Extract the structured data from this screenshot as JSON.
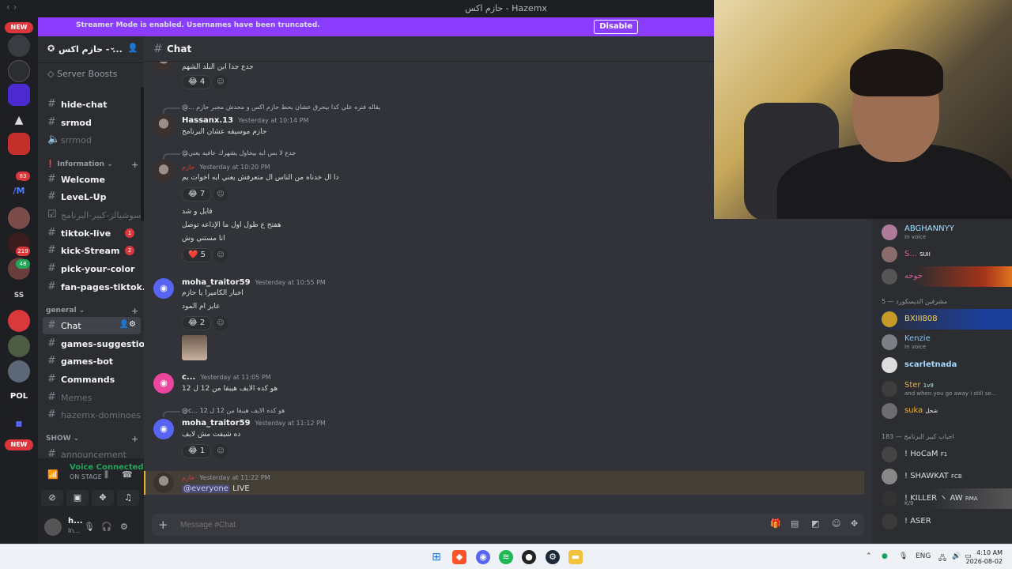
{
  "window": {
    "title": "حازم اكس - Hazemx"
  },
  "banner": {
    "text": "Streamer Mode is enabled. Usernames have been truncated.",
    "button": "Disable"
  },
  "guilds": {
    "new_top": "NEW",
    "new_bottom": "NEW",
    "badge_83": "83",
    "badge_219": "219",
    "badge_48": "48",
    "ss": "SS"
  },
  "server": {
    "name": "حازم اكس - ...",
    "boosts": "Server Boosts"
  },
  "channels": {
    "hide_chat": "hide-chat",
    "srmod": "srmod",
    "srrmod": "srrmod",
    "cat_information": "Information",
    "welcome": "Welcome",
    "level_up": "LeveL-Up",
    "social": "سوشيالز-كبير-البرنامج",
    "tiktok_live": "tiktok-live",
    "tiktok_badge": "1",
    "kick_stream": "kick-Stream",
    "kick_badge": "2",
    "pick_color": "pick-your-color",
    "fan_pages": "fan-pages-tiktok...",
    "cat_general": "general",
    "chat": "Chat",
    "games_suggestions": "games-suggestions",
    "games_bot": "games-bot",
    "commands": "Commands",
    "memes": "Memes",
    "dominoes": "hazemx-dominoes",
    "cat_show": "SHOW",
    "announcement": "announcement"
  },
  "voice": {
    "status": "Voice Connected",
    "stage": "ON STAGE"
  },
  "user": {
    "name": "h...",
    "status": "In..."
  },
  "chat": {
    "channel": "Chat",
    "placeholder": "Message #Chat",
    "messages": [
      {
        "text": "جدع جدا ابن البلد الشهم",
        "reaction": "😂",
        "count": "4"
      },
      {
        "reply": "@... يقاله فتره علي كدا بيحرق عشان يحط حازم اكس و محدش مجبر حازم",
        "name": "Hassanx.13",
        "time": "Yesterday at 10:14 PM",
        "text": "حازم موسيقه عشان البرنامج"
      },
      {
        "reply": "@جدع لا بس ايه بيحاول يشهرك عافيه يعني",
        "name": "حازم",
        "time": "Yesterday at 10:20 PM",
        "text": "دا ال خدناه من الناس ال متعرفش يعني ايه اخوات يم",
        "reaction": "😂",
        "count": "7"
      },
      {
        "text": "قايل و شد"
      },
      {
        "text": "هفتح ع طول اول ما الإذاعه توصل"
      },
      {
        "text": "انا مستني وش",
        "reaction": "❤️",
        "count": "5"
      },
      {
        "name": "moha_traitor59",
        "time": "Yesterday at 10:55 PM",
        "text": "اخبار الكاميرا يا حازم"
      },
      {
        "text": "عايز ام المود",
        "reaction": "😂",
        "count": "2"
      },
      {
        "name": "c...",
        "time": "Yesterday at 11:05 PM",
        "text": "هو كده الايف هيبقا من 12 ل 12"
      },
      {
        "reply": "@c... هو كده الايف هيبقا من 12 ل 12",
        "name": "moha_traitor59",
        "time": "Yesterday at 11:12 PM",
        "text": "ده شيفت مش لايف",
        "reaction": "😂",
        "count": "1"
      },
      {
        "name": "حازم",
        "time": "Yesterday at 11:22 PM",
        "mention": "@everyone",
        "text": "LIVE"
      }
    ]
  },
  "members": {
    "cat_mods": "مشرفين الديسكورد — 5",
    "cat_fans": "احباب كبير البرنامج — 183",
    "list": [
      {
        "name": "ABGHANNYY",
        "sub": "In voice"
      },
      {
        "name": "S...",
        "tag": "SUII"
      },
      {
        "name": "خوخه"
      },
      {
        "name": "BXIII808"
      },
      {
        "name": "Kenzie",
        "sub": "In voice"
      },
      {
        "name": "scarletnada"
      },
      {
        "name": "Ster",
        "tag": "1v9",
        "sub": "and when you go away i still se..."
      },
      {
        "name": "suka",
        "tag": "شحل"
      },
      {
        "name": "! HoCaM",
        "tag": "F1"
      },
      {
        "name": "! SHAWKAT",
        "tag": "FCB"
      },
      {
        "name": "! KILLER ヽ AW",
        "tag": "RMA",
        "sub": "K/9"
      },
      {
        "name": "! ASER"
      }
    ]
  },
  "taskbar": {
    "lang": "ENG",
    "time": "4:10 AM",
    "date": "2026-08-02"
  },
  "colors": {
    "accent": "#5865f2",
    "banner": "#8b3dff",
    "danger": "#da373c",
    "online": "#23a559"
  }
}
